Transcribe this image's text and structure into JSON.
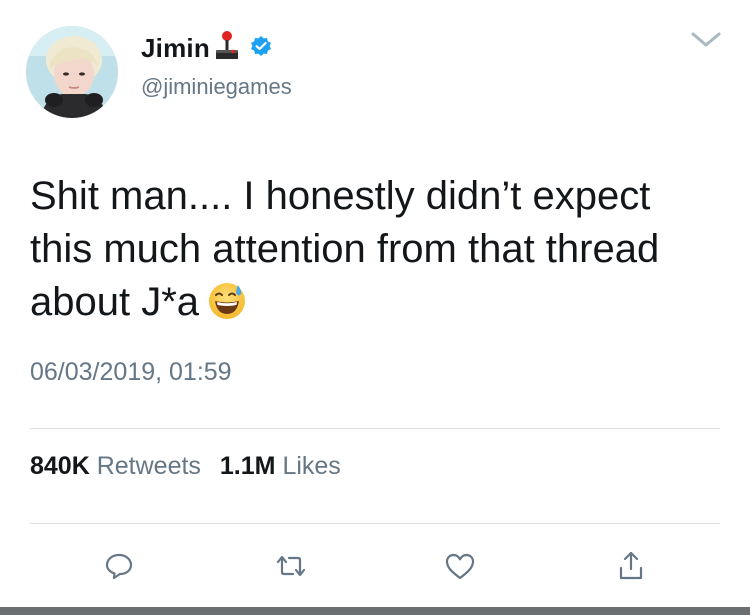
{
  "tweet": {
    "author": {
      "display_name": "Jimin",
      "handle": "@jiminiegames",
      "name_emoji": "joystick-icon",
      "verified": true
    },
    "text_lines": [
      "Shit man.... I honestly didn’t expect",
      "this much attention from that thread",
      "about J*a"
    ],
    "text_emoji": "grinning-face-with-sweat-icon",
    "timestamp": "06/03/2019, 01:59",
    "stats": {
      "retweets_count": "840K",
      "retweets_label": "Retweets",
      "likes_count": "1.1M",
      "likes_label": "Likes"
    }
  },
  "actions": [
    {
      "icon": "reply-icon"
    },
    {
      "icon": "retweet-icon"
    },
    {
      "icon": "like-icon"
    },
    {
      "icon": "share-icon"
    }
  ],
  "colors": {
    "text_primary": "#14171a",
    "text_secondary": "#657786",
    "verified_blue": "#1da1f2",
    "divider": "#d9dee2"
  }
}
